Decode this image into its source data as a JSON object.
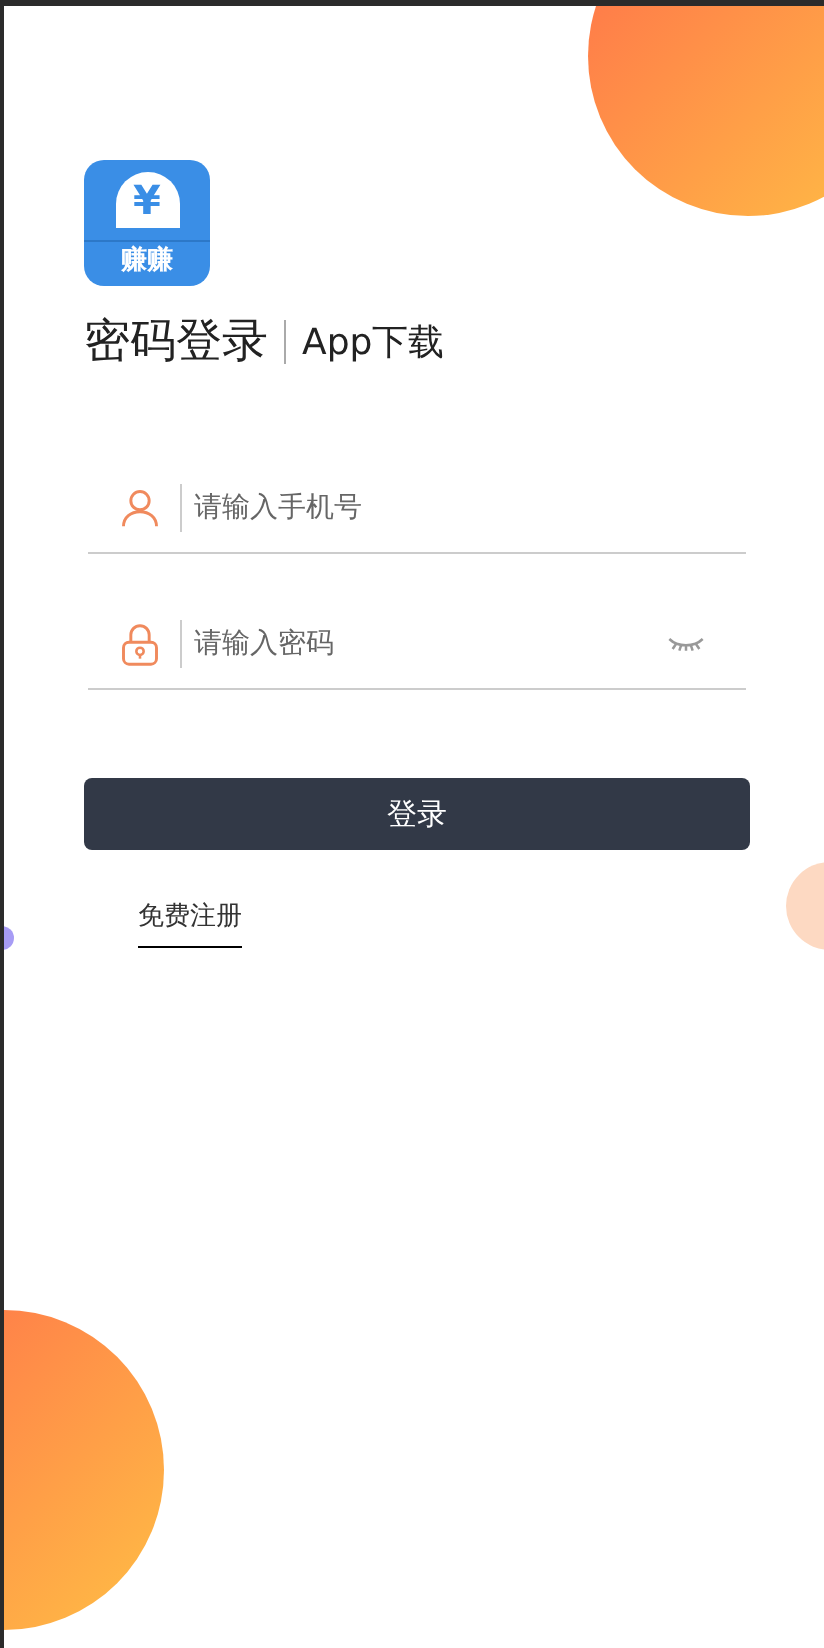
{
  "logo": {
    "symbol": "¥",
    "name": "赚赚"
  },
  "heading": {
    "title": "密码登录",
    "link": "App下载"
  },
  "fields": [
    {
      "kind": "phone",
      "placeholder": "请输入手机号"
    },
    {
      "kind": "password",
      "placeholder": "请输入密码"
    }
  ],
  "login_button": "登录",
  "register_link": "免费注册"
}
